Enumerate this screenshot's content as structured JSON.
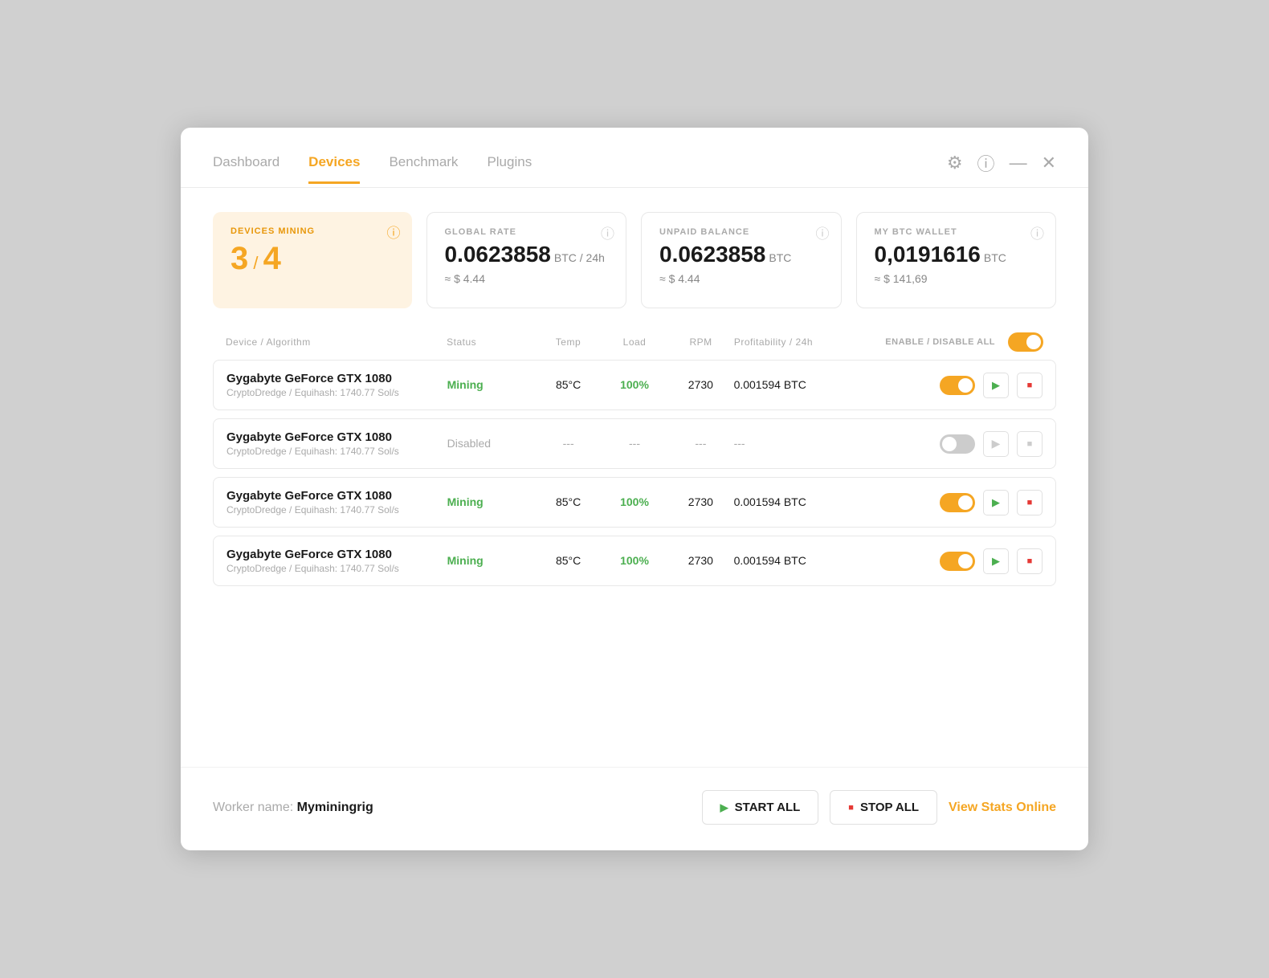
{
  "nav": {
    "tabs": [
      {
        "id": "dashboard",
        "label": "Dashboard",
        "active": false
      },
      {
        "id": "devices",
        "label": "Devices",
        "active": true
      },
      {
        "id": "benchmark",
        "label": "Benchmark",
        "active": false
      },
      {
        "id": "plugins",
        "label": "Plugins",
        "active": false
      }
    ]
  },
  "stats": {
    "devices_mining": {
      "label": "DEVICES MINING",
      "count": "3",
      "total": "4"
    },
    "global_rate": {
      "label": "GLOBAL RATE",
      "value": "0.0623858",
      "unit": "BTC / 24h",
      "sub": "≈ $ 4.44"
    },
    "unpaid_balance": {
      "label": "UNPAID BALANCE",
      "value": "0.0623858",
      "unit": "BTC",
      "sub": "≈ $ 4.44"
    },
    "btc_wallet": {
      "label": "MY BTC WALLET",
      "value": "0,0191616",
      "unit": "BTC",
      "sub": "≈ $ 141,69"
    }
  },
  "table": {
    "columns": {
      "device": "Device / Algorithm",
      "status": "Status",
      "temp": "Temp",
      "load": "Load",
      "rpm": "RPM",
      "profit": "Profitability / 24h",
      "controls": "ENABLE / DISABLE ALL"
    },
    "rows": [
      {
        "id": 1,
        "name": "Gygabyte GeForce GTX 1080",
        "sub": "CryptoDredge / Equihash: 1740.77 Sol/s",
        "status": "Mining",
        "status_type": "mining",
        "temp": "85°C",
        "load": "100%",
        "rpm": "2730",
        "profit": "0.001594 BTC",
        "enabled": true
      },
      {
        "id": 2,
        "name": "Gygabyte GeForce GTX 1080",
        "sub": "CryptoDredge / Equihash: 1740.77 Sol/s",
        "status": "Disabled",
        "status_type": "disabled",
        "temp": "---",
        "load": "---",
        "rpm": "---",
        "profit": "---",
        "enabled": false
      },
      {
        "id": 3,
        "name": "Gygabyte GeForce GTX 1080",
        "sub": "CryptoDredge / Equihash: 1740.77 Sol/s",
        "status": "Mining",
        "status_type": "mining",
        "temp": "85°C",
        "load": "100%",
        "rpm": "2730",
        "profit": "0.001594 BTC",
        "enabled": true
      },
      {
        "id": 4,
        "name": "Gygabyte GeForce GTX 1080",
        "sub": "CryptoDredge / Equihash: 1740.77 Sol/s",
        "status": "Mining",
        "status_type": "mining",
        "temp": "85°C",
        "load": "100%",
        "rpm": "2730",
        "profit": "0.001594 BTC",
        "enabled": true
      }
    ]
  },
  "footer": {
    "worker_label": "Worker name:",
    "worker_name": "Myminingrig",
    "start_all": "START ALL",
    "stop_all": "STOP ALL",
    "view_stats": "View Stats Online"
  }
}
